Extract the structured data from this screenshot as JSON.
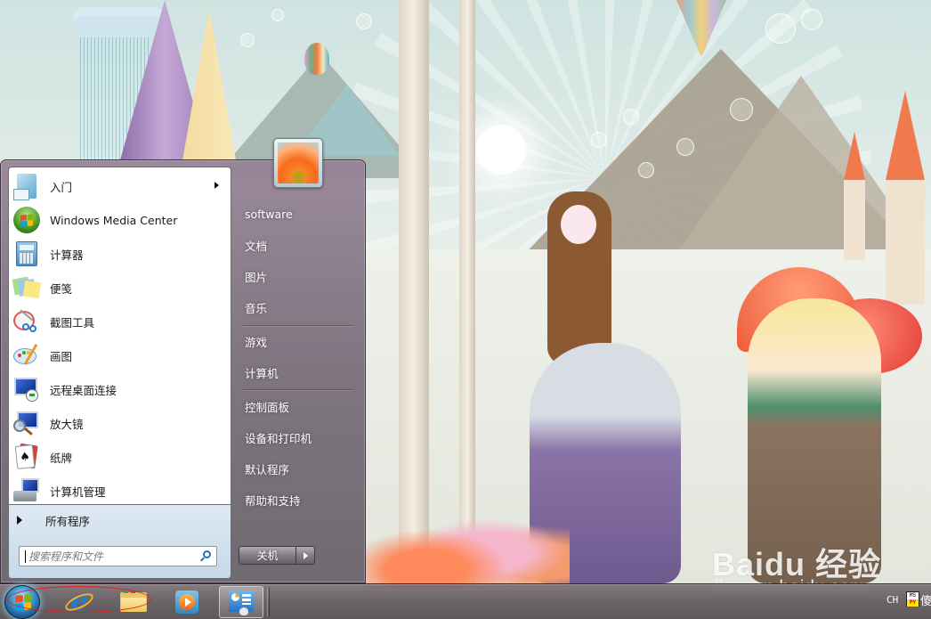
{
  "start_menu": {
    "programs": [
      {
        "label": "入门",
        "icon": "getting-started-icon",
        "has_submenu": true
      },
      {
        "label": "Windows Media Center",
        "icon": "windows-media-center-icon",
        "has_submenu": false
      },
      {
        "label": "计算器",
        "icon": "calculator-icon",
        "has_submenu": false
      },
      {
        "label": "便笺",
        "icon": "sticky-notes-icon",
        "has_submenu": false
      },
      {
        "label": "截图工具",
        "icon": "snipping-tool-icon",
        "has_submenu": false
      },
      {
        "label": "画图",
        "icon": "paint-icon",
        "has_submenu": false
      },
      {
        "label": "远程桌面连接",
        "icon": "remote-desktop-icon",
        "has_submenu": false
      },
      {
        "label": "放大镜",
        "icon": "magnifier-icon",
        "has_submenu": false
      },
      {
        "label": "纸牌",
        "icon": "solitaire-icon",
        "has_submenu": false
      },
      {
        "label": "计算机管理",
        "icon": "computer-management-icon",
        "has_submenu": false
      }
    ],
    "all_programs_label": "所有程序",
    "search": {
      "placeholder": "搜索程序和文件",
      "value": ""
    },
    "user_picture": "flower-user-picture",
    "right_items": [
      {
        "label": "software"
      },
      {
        "label": "文档"
      },
      {
        "label": "图片"
      },
      {
        "label": "音乐"
      },
      {
        "label": "游戏"
      },
      {
        "label": "计算机"
      },
      {
        "label": "控制面板"
      },
      {
        "label": "设备和打印机"
      },
      {
        "label": "默认程序"
      },
      {
        "label": "帮助和支持"
      }
    ],
    "shutdown_label": "关机"
  },
  "taskbar": {
    "pinned": [
      {
        "name": "start-orb",
        "icon": "windows-logo-icon"
      },
      {
        "name": "internet-explorer",
        "icon": "internet-explorer-icon"
      },
      {
        "name": "windows-explorer",
        "icon": "folder-icon"
      },
      {
        "name": "windows-media-player",
        "icon": "media-player-icon"
      },
      {
        "name": "control-panel",
        "icon": "control-panel-icon",
        "active": true
      }
    ],
    "tray": {
      "language": "CH",
      "ime": {
        "top": "MS",
        "bottom": "PY"
      },
      "partial_char": "傻"
    }
  },
  "watermark": {
    "brand": "Bai",
    "brand_mid": "du",
    "brand_cn": "经验",
    "url": "jingyan.baidu.com"
  },
  "colors": {
    "annotation_ellipse": "#e02020",
    "search_icon": "#2a6fb7"
  }
}
